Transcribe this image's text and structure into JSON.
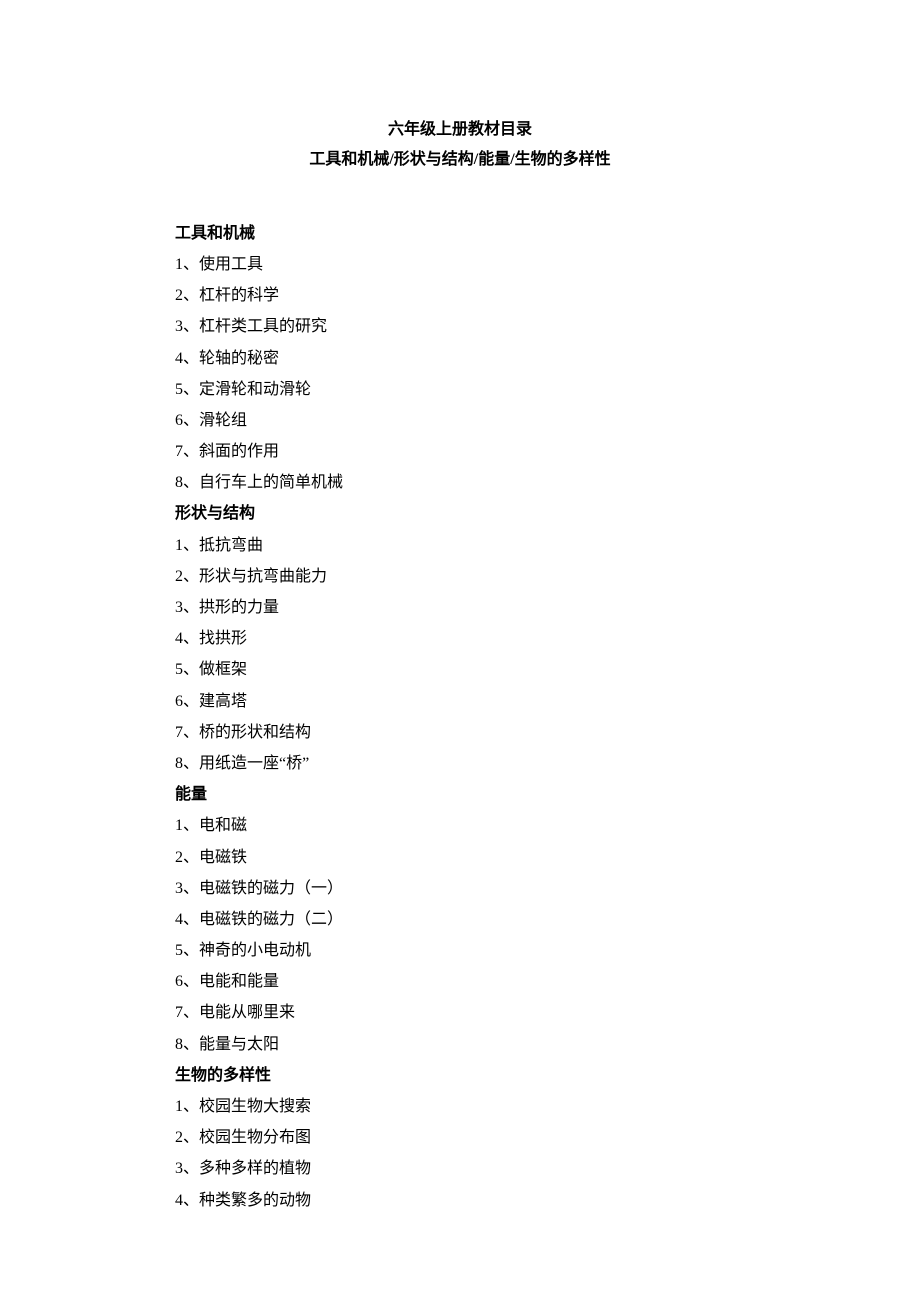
{
  "title": {
    "line1": "六年级上册教材目录",
    "line2": "工具和机械/形状与结构/能量/生物的多样性"
  },
  "sections": [
    {
      "heading": "工具和机械",
      "items": [
        "1、使用工具",
        "2、杠杆的科学",
        "3、杠杆类工具的研究",
        "4、轮轴的秘密",
        "5、定滑轮和动滑轮",
        "6、滑轮组",
        "7、斜面的作用",
        "8、自行车上的简单机械"
      ]
    },
    {
      "heading": "形状与结构",
      "items": [
        "1、抵抗弯曲",
        "2、形状与抗弯曲能力",
        "3、拱形的力量",
        "4、找拱形",
        "5、做框架",
        "6、建高塔",
        "7、桥的形状和结构",
        "8、用纸造一座“桥”"
      ]
    },
    {
      "heading": "能量",
      "items": [
        "1、电和磁",
        "2、电磁铁",
        "3、电磁铁的磁力（一）",
        "4、电磁铁的磁力（二）",
        "5、神奇的小电动机",
        "6、电能和能量",
        "7、电能从哪里来",
        "8、能量与太阳"
      ]
    },
    {
      "heading": "生物的多样性",
      "items": [
        "1、校园生物大搜索",
        "2、校园生物分布图",
        "3、多种多样的植物",
        "4、种类繁多的动物"
      ]
    }
  ]
}
